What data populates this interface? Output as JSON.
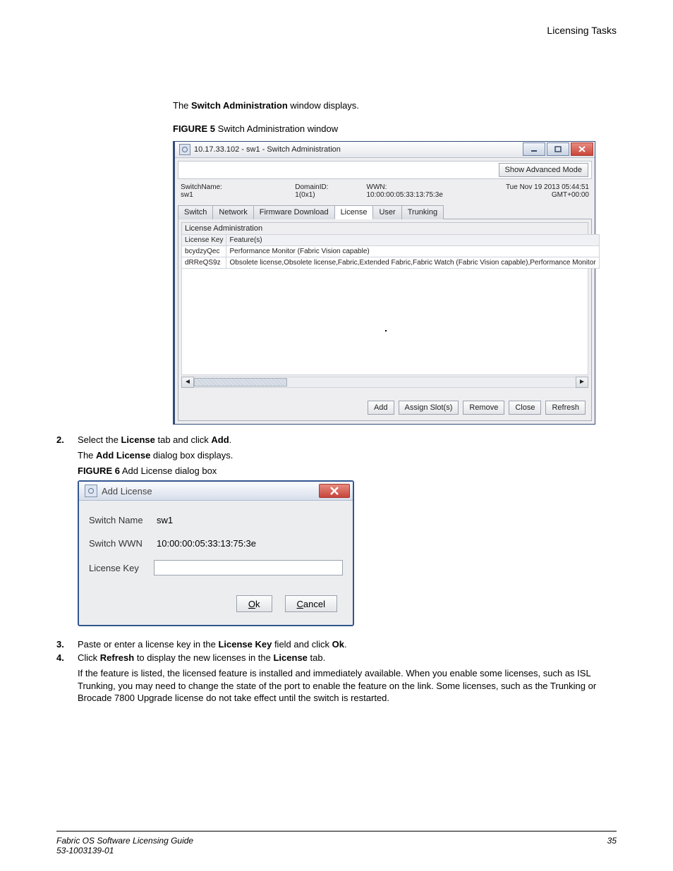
{
  "header": {
    "section": "Licensing Tasks"
  },
  "intro1_pre": "The ",
  "intro1_bold": "Switch Administration",
  "intro1_post": " window displays.",
  "fig5_label": "FIGURE 5",
  "fig5_caption": " Switch Administration window",
  "win1": {
    "title": "10.17.33.102 - sw1 - Switch Administration",
    "show_advanced": "Show Advanced Mode",
    "switchname_label": "SwitchName:",
    "switchname_value": "sw1",
    "domainid": "DomainID: 1(0x1)",
    "wwn": "WWN: 10:00:00:05:33:13:75:3e",
    "timestamp": "Tue Nov 19 2013 05:44:51 GMT+00:00",
    "tabs": [
      "Switch",
      "Network",
      "Firmware Download",
      "License",
      "User",
      "Trunking"
    ],
    "active_tab_index": 3,
    "panel_title": "License Administration",
    "col_key": "License Key",
    "col_feat": "Feature(s)",
    "rows": [
      {
        "key": "bcydzyQec",
        "feat": "Performance Monitor (Fabric Vision capable)"
      },
      {
        "key": "dRReQS9z",
        "feat": "Obsolete license,Obsolete license,Fabric,Extended Fabric,Fabric Watch (Fabric Vision capable),Performance Monitor"
      }
    ],
    "buttons": [
      "Add",
      "Assign Slot(s)",
      "Remove",
      "Close",
      "Refresh"
    ]
  },
  "step2_pre": "Select the ",
  "step2_b1": "License",
  "step2_mid": " tab and click ",
  "step2_b2": "Add",
  "step2_post": ".",
  "step2_sub_pre": "The ",
  "step2_sub_bold": "Add License",
  "step2_sub_post": " dialog box displays.",
  "fig6_label": "FIGURE 6",
  "fig6_caption": " Add License dialog box",
  "win2": {
    "title": "Add License",
    "switch_name_label": "Switch Name",
    "switch_name_value": "sw1",
    "switch_wwn_label": "Switch WWN",
    "switch_wwn_value": "10:00:00:05:33:13:75:3e",
    "license_key_label": "License Key",
    "ok_u": "O",
    "ok_rest": "k",
    "cancel_u": "C",
    "cancel_rest": "ancel"
  },
  "step3_pre": "Paste or enter a license key in the ",
  "step3_b1": "License Key",
  "step3_mid": " field and click ",
  "step3_b2": "Ok",
  "step3_post": ".",
  "step4_pre": "Click ",
  "step4_b1": "Refresh",
  "step4_mid": " to display the new licenses in the ",
  "step4_b2": "License",
  "step4_post": " tab.",
  "step4_note": "If the feature is listed, the licensed feature is installed and immediately available. When you enable some licenses, such as ISL Trunking, you may need to change the state of the port to enable the feature on the link. Some licenses, such as the Trunking or Brocade 7800 Upgrade license do not take effect until the switch is restarted.",
  "footer": {
    "line1": "Fabric OS Software Licensing Guide",
    "line2": "53-1003139-01",
    "page": "35"
  },
  "nums": {
    "n2": "2.",
    "n3": "3.",
    "n4": "4."
  }
}
